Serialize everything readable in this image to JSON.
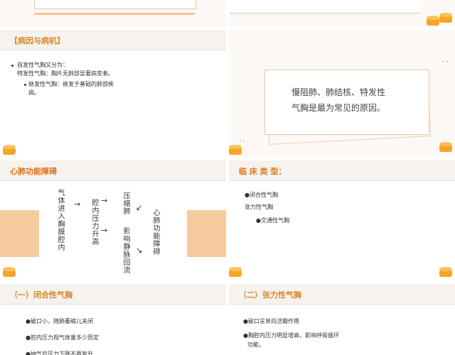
{
  "slide_top_left": {},
  "slide_top_right": {},
  "slide_etiology": {
    "title": "【病因与病机】",
    "bullet1": "自发性气胸又分为：",
    "line1b": "特发性气胸：胸片无肺部显著病变者。",
    "bullet2": "继发性气胸：继发于基础的肺部疾",
    "line2b": "病。"
  },
  "slide_quote": {
    "line1": "慢阻肺、肺结核、特发性",
    "line2": "气胸是最为常见的原因。"
  },
  "slide_cardiopulmonary": {
    "title": "心肺功能障碍",
    "col1": "气体进入胸膜腔内",
    "col2": "腔内压力升高",
    "col3a": "压缩肺",
    "col3b": "影响静脉回流",
    "col4": "心肺功能障碍",
    "arrow_right": "→",
    "arrow_down_left": "↙",
    "arrow_down_right": "↘"
  },
  "slide_clinical_types": {
    "title": "临 床 类 型：",
    "item1": "●闭合性气胸",
    "item2": "张力性气胸",
    "item3": "●交通性气胸"
  },
  "slide_closed": {
    "title": "（一）闭合性气胸",
    "item1": "●破口小，随肺萎缩儿关闭",
    "item2": "●腔内压力视气体量多少而定",
    "item3": "●抽气后压力下降不再复升"
  },
  "slide_tension": {
    "title": "（二）张力性气胸",
    "item1": "●破口呈单向活瓣作用",
    "item2a": "●胸腔内压力明显增高，影响呼吸循环",
    "item2b": "功能。"
  },
  "colors": {
    "accent": "#d98a2b",
    "coin": "#f5a623",
    "peach": "#f7cba0",
    "header_bg": "#f6f2ee"
  }
}
